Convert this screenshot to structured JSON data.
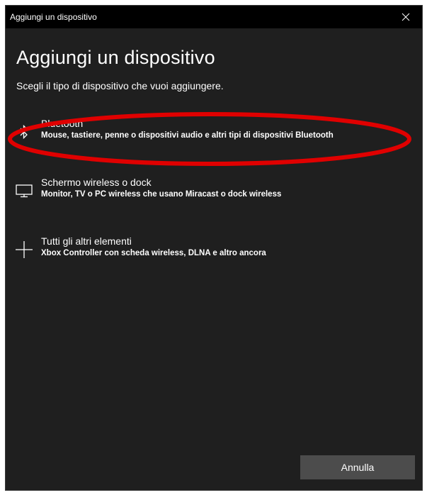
{
  "window": {
    "title": "Aggiungi un dispositivo"
  },
  "heading": "Aggiungi un dispositivo",
  "subheading": "Scegli il tipo di dispositivo che vuoi aggiungere.",
  "options": [
    {
      "label": "Bluetooth",
      "description": "Mouse, tastiere, penne o dispositivi audio e altri tipi di dispositivi Bluetooth",
      "icon": "bluetooth-icon"
    },
    {
      "label": "Schermo wireless o dock",
      "description": "Monitor, TV o PC wireless che usano Miracast o dock wireless",
      "icon": "monitor-icon"
    },
    {
      "label": "Tutti gli altri elementi",
      "description": "Xbox Controller con scheda wireless, DLNA e altro ancora",
      "icon": "plus-icon"
    }
  ],
  "buttons": {
    "cancel": "Annulla"
  },
  "colors": {
    "background": "#1f1f1f",
    "titlebar": "#000000",
    "button": "#4c4c4c",
    "highlight": "#e00000"
  }
}
